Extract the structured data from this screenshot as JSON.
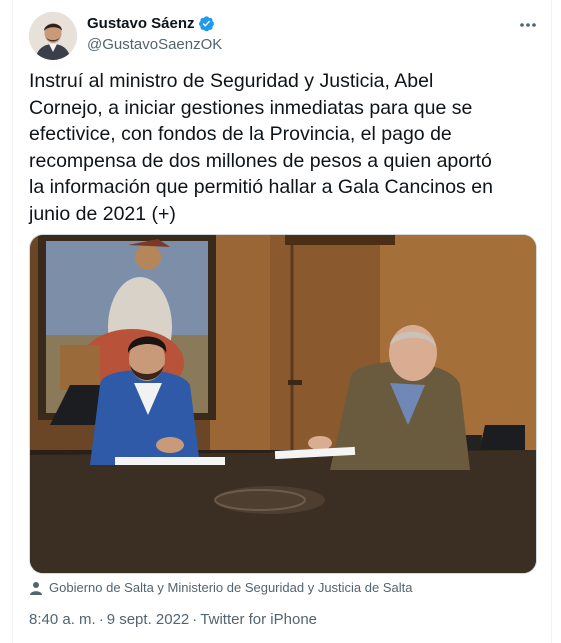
{
  "author": {
    "display_name": "Gustavo Sáenz",
    "handle": "@GustavoSaenzOK",
    "verified": true,
    "verified_color": "#1d9bf0"
  },
  "tweet": {
    "text": "Instruí al ministro de Seguridad y Justicia, Abel\nCornejo, a iniciar gestiones inmediatas para que se\nefectivice, con fondos de la Provincia, el pago de\nrecompensa de dos millones de pesos a quien aportó\nla información que permitió hallar a Gala Cancinos en\njunio de 2021 (+)"
  },
  "media": {
    "tagged_users": "Gobierno de Salta y Ministerio de Seguridad y Justicia de Salta"
  },
  "meta": {
    "time": "8:40 a. m.",
    "separator": "·",
    "date": "9 sept. 2022",
    "source": "Twitter for iPhone"
  },
  "icons": {
    "more": "more-horizontal-icon",
    "verified": "verified-badge-icon",
    "tag": "person-icon"
  },
  "colors": {
    "text": "#0f1419",
    "secondary": "#536471",
    "border": "#cfd9de"
  }
}
